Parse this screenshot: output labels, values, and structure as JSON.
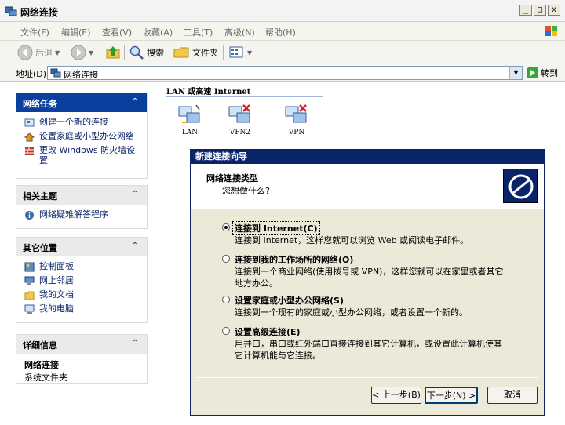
{
  "window": {
    "title": "网络连接",
    "controls": [
      "_",
      "□",
      "x"
    ]
  },
  "menu": [
    "文件(F)",
    "编辑(E)",
    "查看(V)",
    "收藏(A)",
    "工具(T)",
    "高级(N)",
    "帮助(H)"
  ],
  "toolbar": {
    "back": "后退",
    "search": "搜索",
    "folders": "文件夹"
  },
  "address": {
    "label": "地址(D)",
    "value": "网络连接",
    "go": "转到"
  },
  "sidebar": {
    "tasks": {
      "title": "网络任务",
      "items": [
        {
          "label": "创建一个新的连接"
        },
        {
          "label": "设置家庭或小型办公网络"
        },
        {
          "label": "更改 Windows 防火墙设置"
        }
      ]
    },
    "related": {
      "title": "相关主题",
      "items": [
        {
          "label": "网络疑难解答程序"
        }
      ]
    },
    "places": {
      "title": "其它位置",
      "items": [
        {
          "label": "控制面板"
        },
        {
          "label": "网上邻居"
        },
        {
          "label": "我的文档"
        },
        {
          "label": "我的电脑"
        }
      ]
    },
    "details": {
      "title": "详细信息",
      "name": "网络连接",
      "type": "系统文件夹"
    }
  },
  "main": {
    "group_header": "LAN 或高速 Internet",
    "connections": [
      {
        "label": "LAN"
      },
      {
        "label": "VPN2"
      },
      {
        "label": "VPN"
      }
    ]
  },
  "wizard": {
    "title": "新建连接向导",
    "header_title": "网络连接类型",
    "header_sub": "您想做什么?",
    "options": [
      {
        "label": "连接到 Internet(C)",
        "desc": "连接到 Internet，这样您就可以浏览 Web 或阅读电子邮件。",
        "checked": true
      },
      {
        "label": "连接到我的工作场所的网络(O)",
        "desc": "连接到一个商业网络(使用拨号或 VPN)，这样您就可以在家里或者其它地方办公。",
        "checked": false
      },
      {
        "label": "设置家庭或小型办公网络(S)",
        "desc": "连接到一个现有的家庭或小型办公网络，或者设置一个新的。",
        "checked": false
      },
      {
        "label": "设置高级连接(E)",
        "desc": "用并口，串口或红外端口直接连接到其它计算机，或设置此计算机使其它计算机能与它连接。",
        "checked": false
      }
    ],
    "buttons": {
      "back": "< 上一步(B)",
      "next": "下一步(N) >",
      "cancel": "取消"
    }
  },
  "colors": {
    "task_header": "#0a3fa0",
    "wizard_title": "#0a246a",
    "link": "#0a246a"
  }
}
